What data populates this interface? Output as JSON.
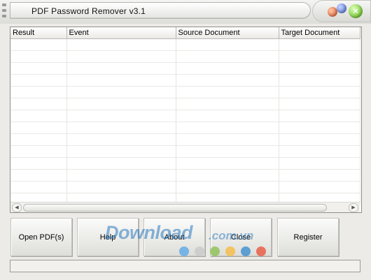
{
  "window": {
    "title": "PDF Password Remover v3.1"
  },
  "table": {
    "columns": [
      "Result",
      "Event",
      "Source Document",
      "Target Document"
    ],
    "rows": []
  },
  "buttons": {
    "open": "Open PDF(s)",
    "help": "Help",
    "about": "About",
    "close": "Close",
    "register": "Register"
  },
  "watermark": {
    "text": "Download",
    "suffix": ".com.vn",
    "dot_colors": [
      "#5aa9e6",
      "#c9c9c9",
      "#8cc152",
      "#f6bb42",
      "#3b8ed0",
      "#e9573f"
    ]
  },
  "status": {
    "text": ""
  },
  "icons": {
    "minimize": "orange-ball-icon",
    "maximize": "blue-ball-icon",
    "close": "green-close-icon"
  },
  "colors": {
    "window_bg": "#ecebe7",
    "close_green": "#59b514"
  }
}
